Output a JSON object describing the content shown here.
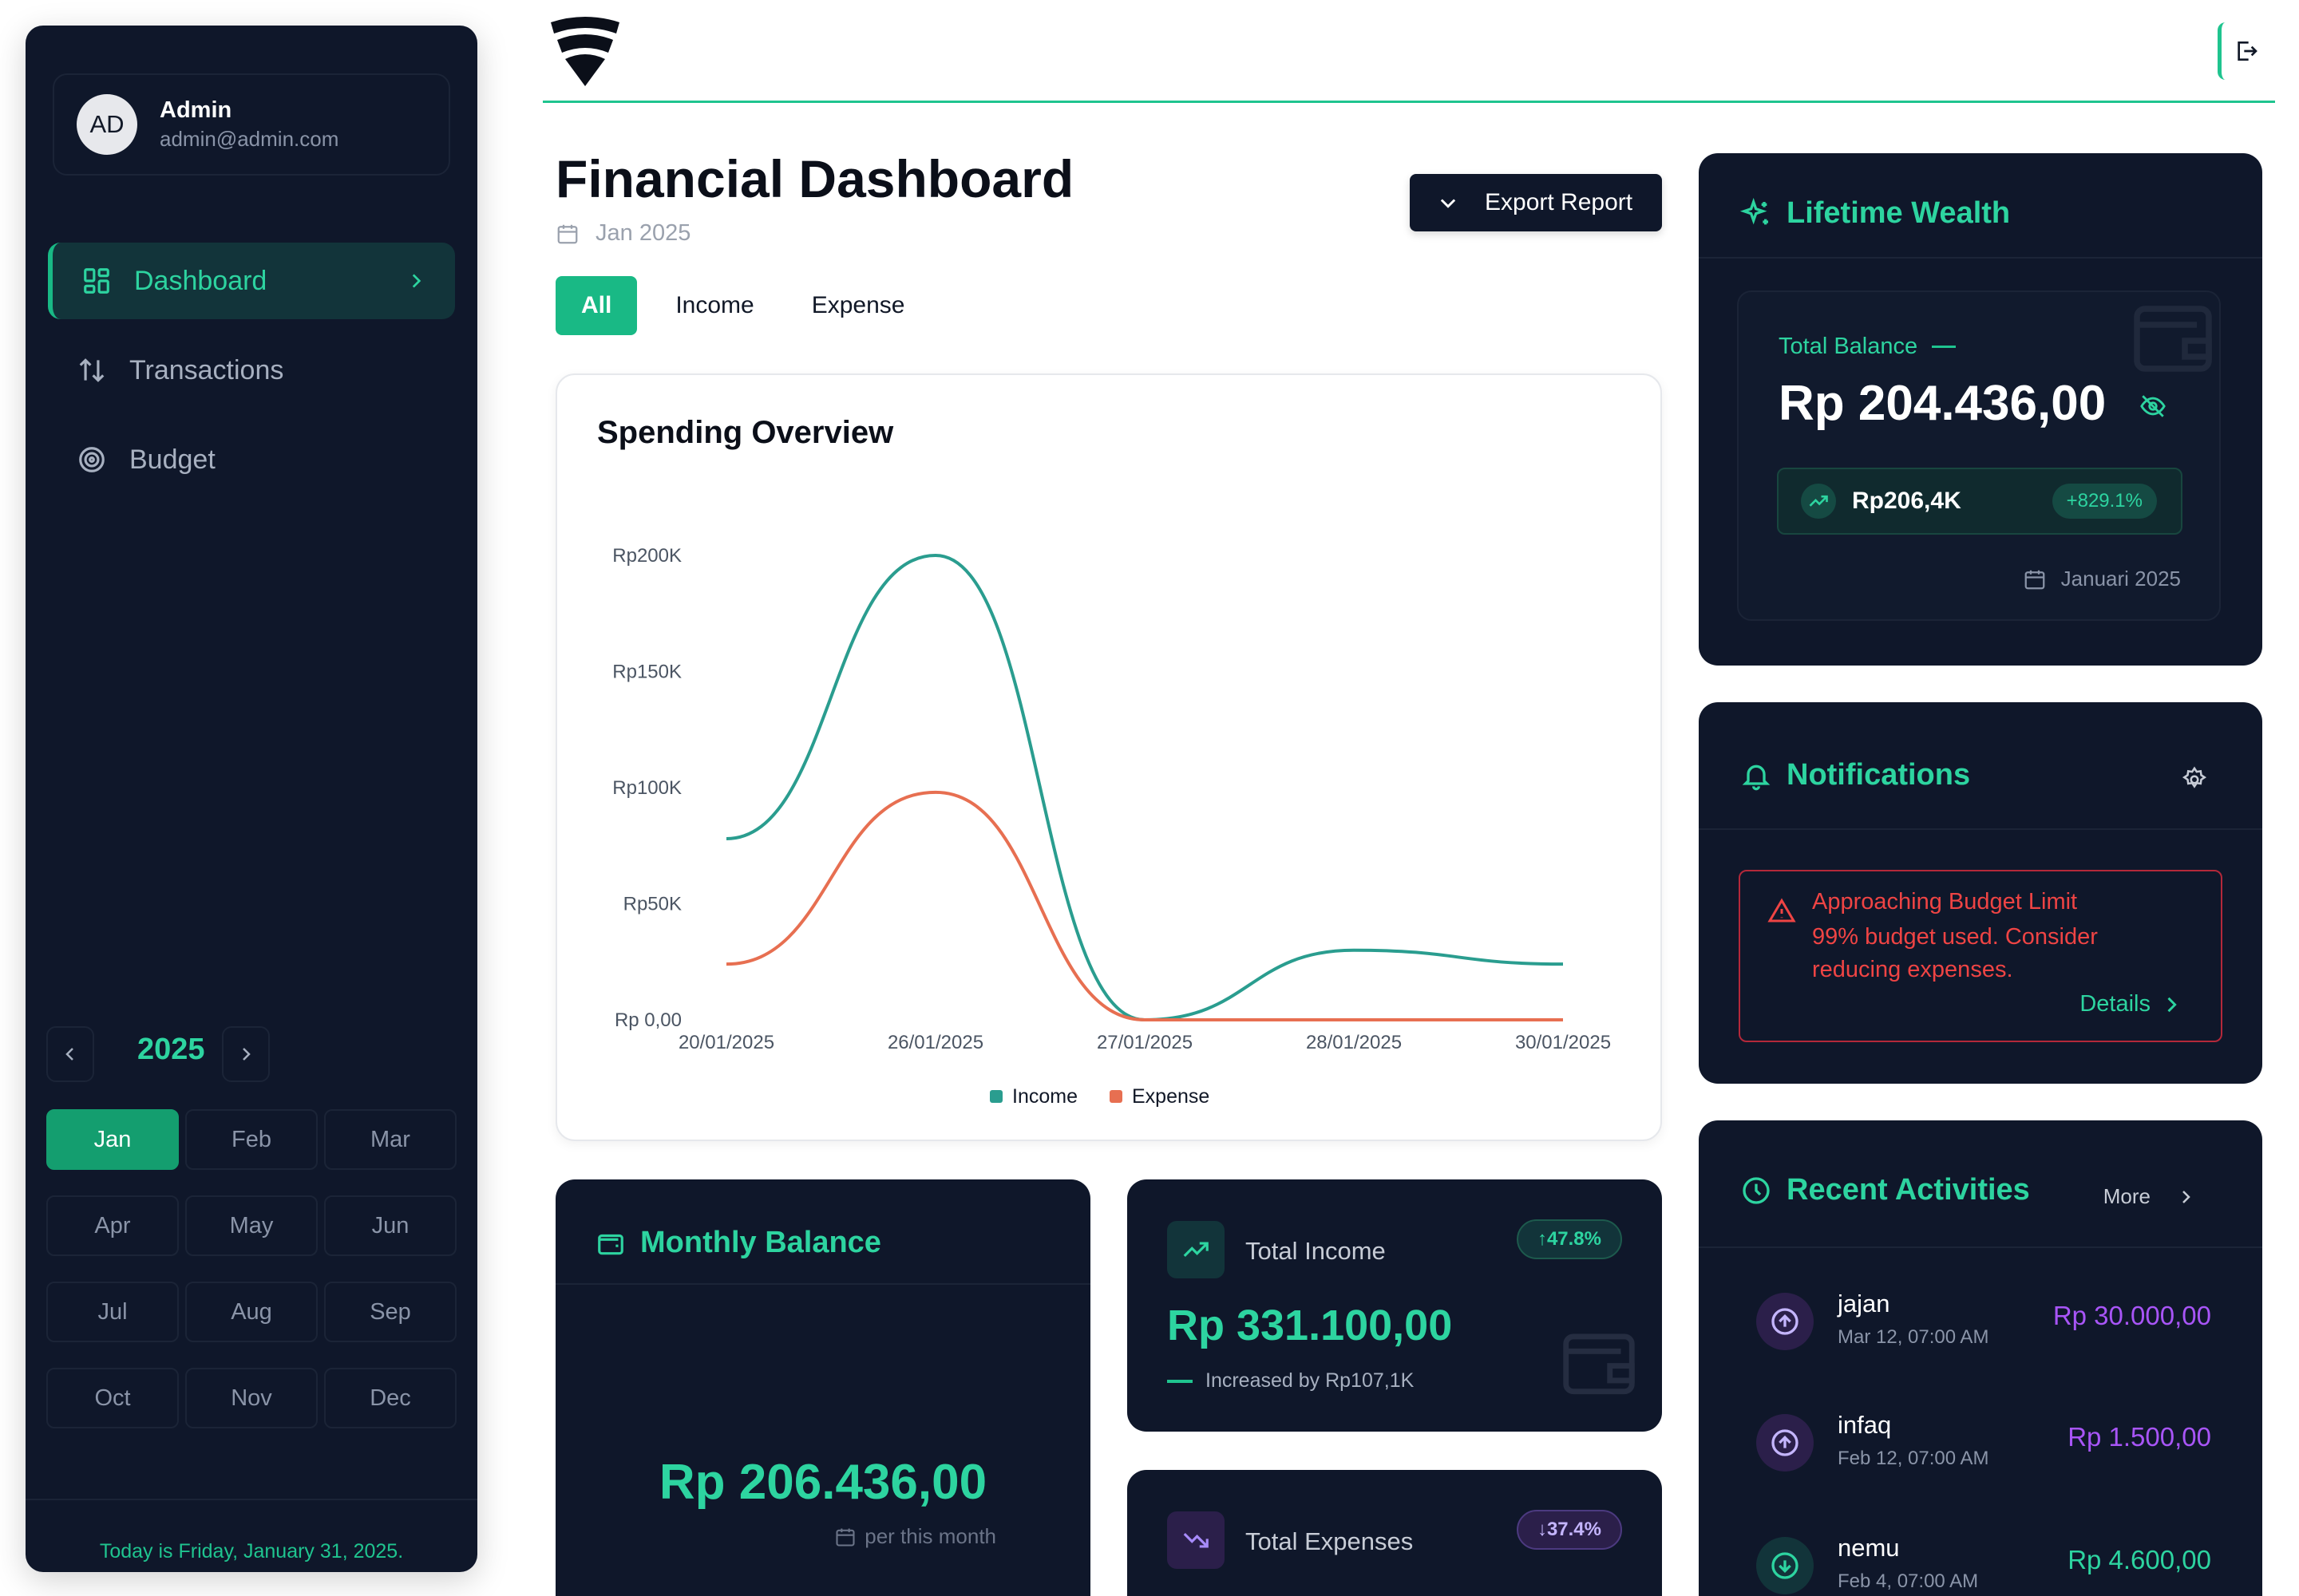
{
  "user": {
    "initials": "AD",
    "name": "Admin",
    "email": "admin@admin.com"
  },
  "nav": {
    "items": [
      {
        "label": "Dashboard",
        "icon": "dashboard-icon",
        "active": true
      },
      {
        "label": "Transactions",
        "icon": "arrows-updown-icon",
        "active": false
      },
      {
        "label": "Budget",
        "icon": "target-icon",
        "active": false
      }
    ]
  },
  "calendar": {
    "year": "2025",
    "months": [
      "Jan",
      "Feb",
      "Mar",
      "Apr",
      "May",
      "Jun",
      "Jul",
      "Aug",
      "Sep",
      "Oct",
      "Nov",
      "Dec"
    ],
    "selected_month": "Jan",
    "today_text": "Today is Friday, January 31, 2025."
  },
  "header": {
    "title": "Financial Dashboard",
    "date": "Jan 2025",
    "export_label": "Export Report",
    "tabs": [
      "All",
      "Income",
      "Expense"
    ],
    "active_tab": "All"
  },
  "chart": {
    "title": "Spending Overview"
  },
  "chart_data": {
    "type": "line",
    "title": "Spending Overview",
    "x": [
      "20/01/2025",
      "26/01/2025",
      "27/01/2025",
      "28/01/2025",
      "30/01/2025"
    ],
    "y_ticks": [
      "Rp 0,00",
      "Rp50K",
      "Rp100K",
      "Rp150K",
      "Rp200K"
    ],
    "ylim": [
      0,
      200000
    ],
    "series": [
      {
        "name": "Income",
        "color": "#2a9d8f",
        "values": [
          78000,
          200000,
          0,
          30000,
          24000
        ]
      },
      {
        "name": "Expense",
        "color": "#e76f51",
        "values": [
          24000,
          98000,
          0,
          0,
          0
        ]
      }
    ],
    "legend": "bottom-center",
    "grid": false
  },
  "monthly_balance": {
    "title": "Monthly Balance",
    "amount": "Rp 206.436,00",
    "sub": "per this month"
  },
  "total_income": {
    "title": "Total Income",
    "badge": "↑47.8%",
    "amount": "Rp 331.100,00",
    "note": "Increased by Rp107,1K"
  },
  "total_expenses": {
    "title": "Total Expenses",
    "badge": "↓37.4%"
  },
  "wealth": {
    "title": "Lifetime Wealth",
    "label": "Total Balance",
    "amount": "Rp 204.436,00",
    "growth_value": "Rp206,4K",
    "growth_pct": "+829.1%",
    "date": "Januari 2025"
  },
  "notifications": {
    "title": "Notifications",
    "alert_title": "Approaching Budget Limit",
    "alert_message": "99% budget used. Consider reducing expenses.",
    "alert_link": "Details"
  },
  "recent": {
    "title": "Recent Activities",
    "more_label": "More",
    "items": [
      {
        "name": "jajan",
        "date": "Mar 12, 07:00 AM",
        "amount": "Rp 30.000,00",
        "kind": "expense"
      },
      {
        "name": "infaq",
        "date": "Feb 12, 07:00 AM",
        "amount": "Rp 1.500,00",
        "kind": "expense"
      },
      {
        "name": "nemu",
        "date": "Feb 4, 07:00 AM",
        "amount": "Rp 4.600,00",
        "kind": "income"
      }
    ]
  },
  "colors": {
    "accent": "#1fc48f",
    "sidebar_bg": "#0f172a",
    "income": "#2a9d8f",
    "expense": "#e76f51",
    "expense_text": "#a855f7",
    "alert": "#ef4444"
  }
}
